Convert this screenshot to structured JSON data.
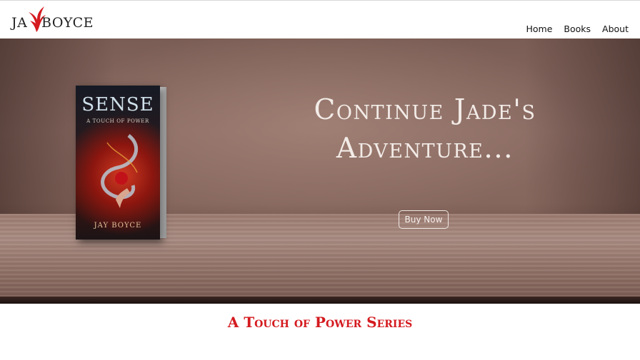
{
  "header": {
    "logo": {
      "first": "JA",
      "second": "BOYCE"
    },
    "nav": [
      {
        "label": "Home"
      },
      {
        "label": "Books"
      },
      {
        "label": "About"
      }
    ]
  },
  "hero": {
    "heading_line1": "Continue Jade's",
    "heading_line2": "Adventure...",
    "button_label": "Buy Now",
    "book": {
      "title": "SENSE",
      "subtitle": "A TOUCH OF POWER",
      "author": "JAY BOYCE"
    }
  },
  "section": {
    "title": "A Touch of Power Series"
  },
  "colors": {
    "accent": "#d41a1f",
    "logo_bird": "#d41a1f",
    "hero_text": "#f3ece8"
  },
  "icons": {
    "logo": "phoenix-icon"
  }
}
